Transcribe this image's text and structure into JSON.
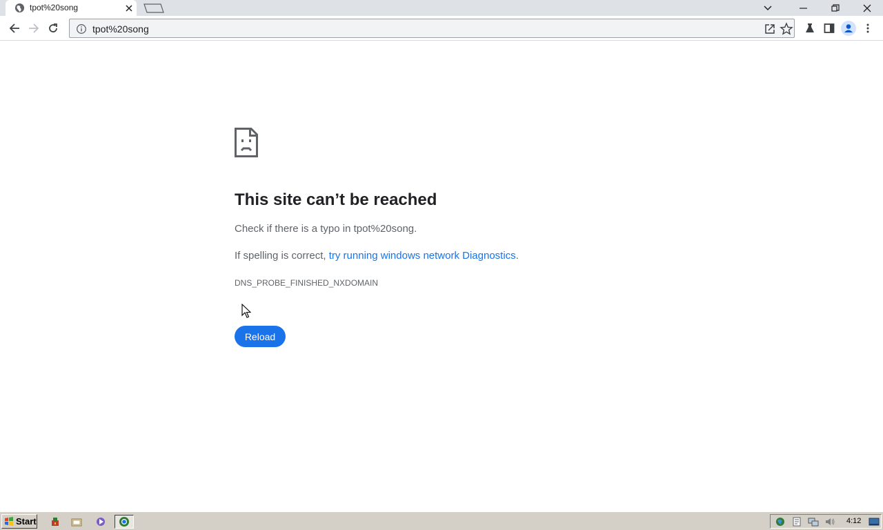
{
  "browser": {
    "tab": {
      "title": "tpot%20song"
    },
    "address": {
      "text": "tpot%20song"
    }
  },
  "error_page": {
    "heading": "This site can’t be reached",
    "typo_line": "Check if there is a typo in tpot%20song.",
    "spelling_prefix": "If spelling is correct, ",
    "diagnostics_link": "try running windows network Diagnostics",
    "spelling_suffix": ".",
    "error_code": "DNS_PROBE_FINISHED_NXDOMAIN",
    "reload_label": "Reload"
  },
  "taskbar": {
    "start_label": "Start",
    "clock": "4:12"
  },
  "colors": {
    "accent": "#1a73e8",
    "tabstrip": "#dee1e6",
    "taskbar": "#d4d0c8"
  },
  "icons": [
    "globe-icon",
    "close-icon",
    "new-tab-icon",
    "chevron-down-icon",
    "minimize-icon",
    "restore-icon",
    "window-close-icon",
    "back-arrow-icon",
    "forward-arrow-icon",
    "reload-icon",
    "info-icon",
    "share-icon",
    "star-icon",
    "labs-flask-icon",
    "side-panel-icon",
    "profile-icon",
    "kebab-menu-icon",
    "sad-page-icon",
    "mouse-cursor-icon"
  ]
}
